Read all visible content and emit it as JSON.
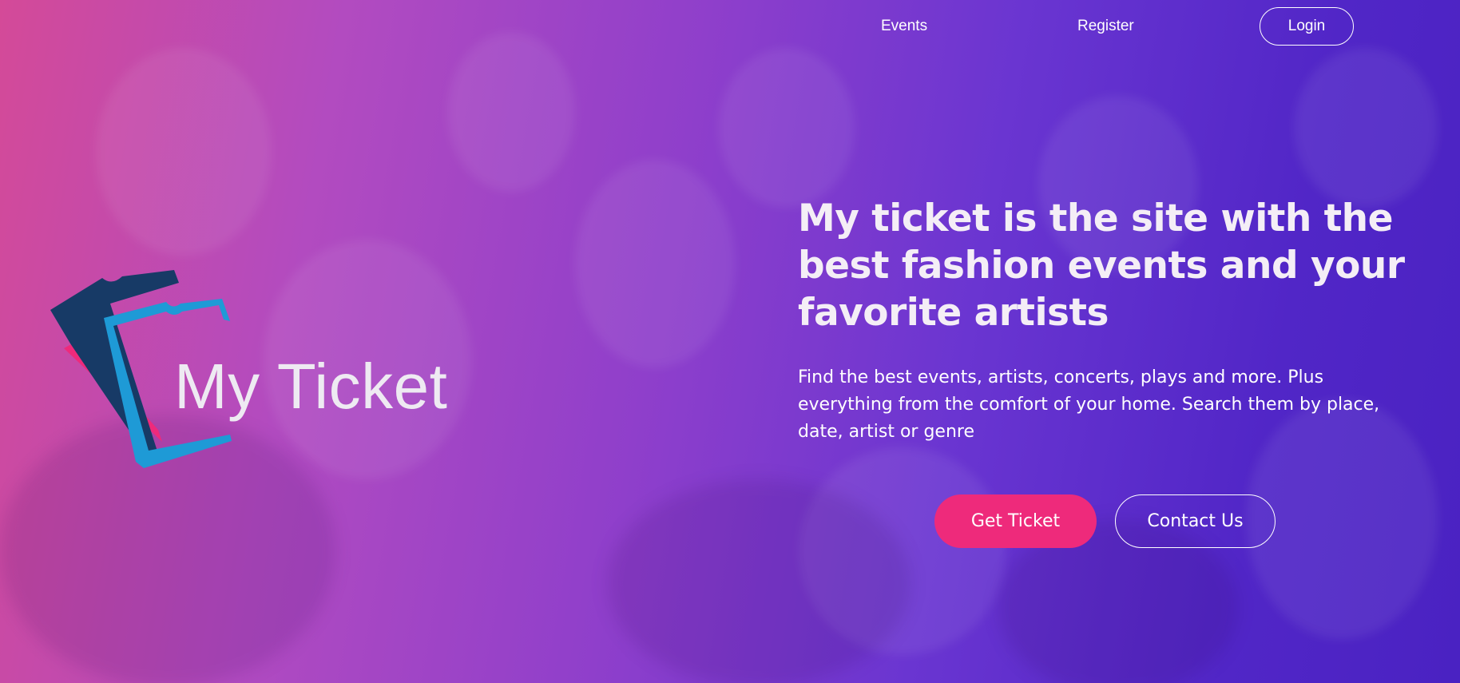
{
  "nav": {
    "events_label": "Events",
    "register_label": "Register",
    "login_label": "Login"
  },
  "logo": {
    "text": "My Ticket",
    "colors": {
      "dark_ticket": "#173a66",
      "blue_ticket": "#1e9ad6",
      "pink_ticket": "#ee2a7b"
    }
  },
  "hero": {
    "headline": "My ticket is the site with the best fashion events and your favorite artists",
    "subtext": "Find the best events, artists, concerts, plays and more. Plus everything from the comfort of your home. Search them by place, date, artist or genre",
    "primary_button": "Get Ticket",
    "secondary_button": "Contact Us"
  },
  "colors": {
    "accent": "#ee2a7b",
    "gradient_start": "#d44a98",
    "gradient_end": "#4a22c2"
  }
}
